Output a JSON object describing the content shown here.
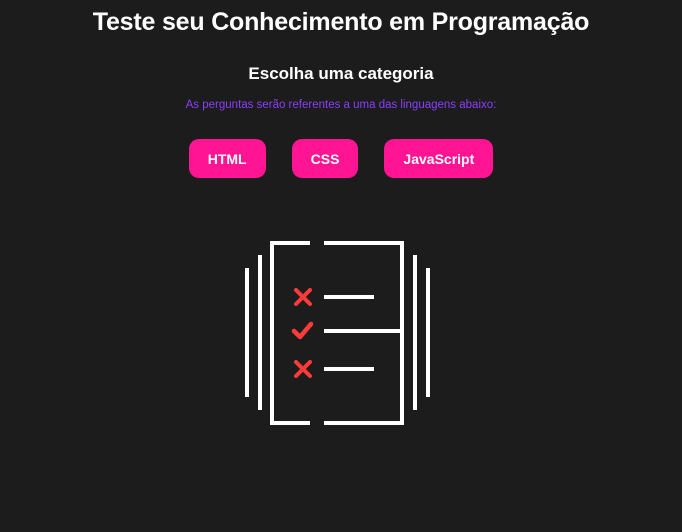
{
  "header": {
    "title": "Teste seu Conhecimento em Programação"
  },
  "category": {
    "heading": "Escolha uma categoria",
    "hint": "As perguntas serão referentes a uma das linguagens abaixo:"
  },
  "buttons": [
    {
      "label": "HTML"
    },
    {
      "label": "CSS"
    },
    {
      "label": "JavaScript"
    }
  ],
  "illustration": {
    "icon": "quiz-checklist-icon",
    "marks": [
      "cross-icon",
      "check-icon",
      "cross-icon"
    ]
  },
  "colors": {
    "background": "#1c1c1c",
    "text": "#ffffff",
    "accent": "#ff1493",
    "hint": "#8a3ffc",
    "mark": "#ff3b3b"
  }
}
